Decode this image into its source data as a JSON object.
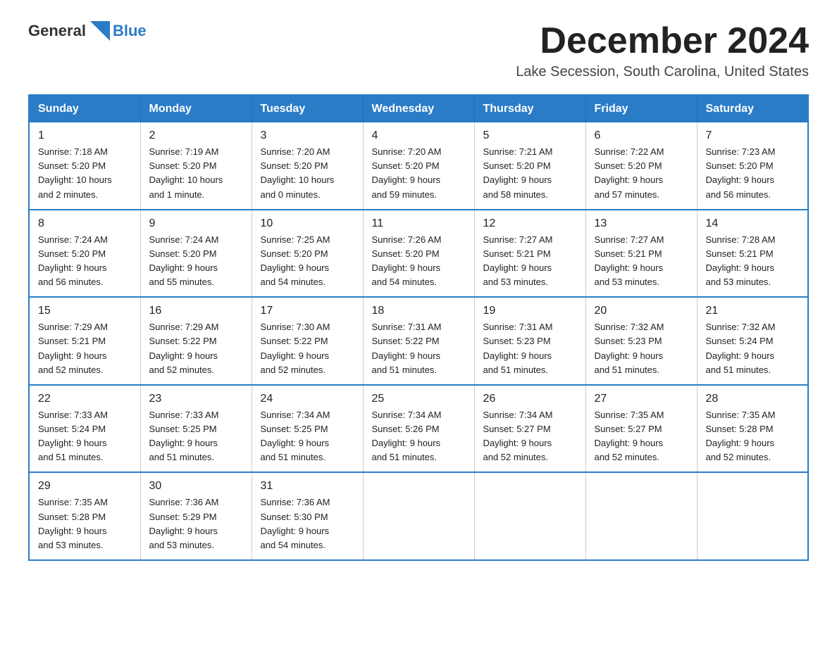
{
  "logo": {
    "general": "General",
    "blue": "Blue"
  },
  "header": {
    "title": "December 2024",
    "subtitle": "Lake Secession, South Carolina, United States"
  },
  "weekdays": [
    "Sunday",
    "Monday",
    "Tuesday",
    "Wednesday",
    "Thursday",
    "Friday",
    "Saturday"
  ],
  "weeks": [
    [
      {
        "day": "1",
        "sunrise": "7:18 AM",
        "sunset": "5:20 PM",
        "daylight": "10 hours and 2 minutes."
      },
      {
        "day": "2",
        "sunrise": "7:19 AM",
        "sunset": "5:20 PM",
        "daylight": "10 hours and 1 minute."
      },
      {
        "day": "3",
        "sunrise": "7:20 AM",
        "sunset": "5:20 PM",
        "daylight": "10 hours and 0 minutes."
      },
      {
        "day": "4",
        "sunrise": "7:20 AM",
        "sunset": "5:20 PM",
        "daylight": "9 hours and 59 minutes."
      },
      {
        "day": "5",
        "sunrise": "7:21 AM",
        "sunset": "5:20 PM",
        "daylight": "9 hours and 58 minutes."
      },
      {
        "day": "6",
        "sunrise": "7:22 AM",
        "sunset": "5:20 PM",
        "daylight": "9 hours and 57 minutes."
      },
      {
        "day": "7",
        "sunrise": "7:23 AM",
        "sunset": "5:20 PM",
        "daylight": "9 hours and 56 minutes."
      }
    ],
    [
      {
        "day": "8",
        "sunrise": "7:24 AM",
        "sunset": "5:20 PM",
        "daylight": "9 hours and 56 minutes."
      },
      {
        "day": "9",
        "sunrise": "7:24 AM",
        "sunset": "5:20 PM",
        "daylight": "9 hours and 55 minutes."
      },
      {
        "day": "10",
        "sunrise": "7:25 AM",
        "sunset": "5:20 PM",
        "daylight": "9 hours and 54 minutes."
      },
      {
        "day": "11",
        "sunrise": "7:26 AM",
        "sunset": "5:20 PM",
        "daylight": "9 hours and 54 minutes."
      },
      {
        "day": "12",
        "sunrise": "7:27 AM",
        "sunset": "5:21 PM",
        "daylight": "9 hours and 53 minutes."
      },
      {
        "day": "13",
        "sunrise": "7:27 AM",
        "sunset": "5:21 PM",
        "daylight": "9 hours and 53 minutes."
      },
      {
        "day": "14",
        "sunrise": "7:28 AM",
        "sunset": "5:21 PM",
        "daylight": "9 hours and 53 minutes."
      }
    ],
    [
      {
        "day": "15",
        "sunrise": "7:29 AM",
        "sunset": "5:21 PM",
        "daylight": "9 hours and 52 minutes."
      },
      {
        "day": "16",
        "sunrise": "7:29 AM",
        "sunset": "5:22 PM",
        "daylight": "9 hours and 52 minutes."
      },
      {
        "day": "17",
        "sunrise": "7:30 AM",
        "sunset": "5:22 PM",
        "daylight": "9 hours and 52 minutes."
      },
      {
        "day": "18",
        "sunrise": "7:31 AM",
        "sunset": "5:22 PM",
        "daylight": "9 hours and 51 minutes."
      },
      {
        "day": "19",
        "sunrise": "7:31 AM",
        "sunset": "5:23 PM",
        "daylight": "9 hours and 51 minutes."
      },
      {
        "day": "20",
        "sunrise": "7:32 AM",
        "sunset": "5:23 PM",
        "daylight": "9 hours and 51 minutes."
      },
      {
        "day": "21",
        "sunrise": "7:32 AM",
        "sunset": "5:24 PM",
        "daylight": "9 hours and 51 minutes."
      }
    ],
    [
      {
        "day": "22",
        "sunrise": "7:33 AM",
        "sunset": "5:24 PM",
        "daylight": "9 hours and 51 minutes."
      },
      {
        "day": "23",
        "sunrise": "7:33 AM",
        "sunset": "5:25 PM",
        "daylight": "9 hours and 51 minutes."
      },
      {
        "day": "24",
        "sunrise": "7:34 AM",
        "sunset": "5:25 PM",
        "daylight": "9 hours and 51 minutes."
      },
      {
        "day": "25",
        "sunrise": "7:34 AM",
        "sunset": "5:26 PM",
        "daylight": "9 hours and 51 minutes."
      },
      {
        "day": "26",
        "sunrise": "7:34 AM",
        "sunset": "5:27 PM",
        "daylight": "9 hours and 52 minutes."
      },
      {
        "day": "27",
        "sunrise": "7:35 AM",
        "sunset": "5:27 PM",
        "daylight": "9 hours and 52 minutes."
      },
      {
        "day": "28",
        "sunrise": "7:35 AM",
        "sunset": "5:28 PM",
        "daylight": "9 hours and 52 minutes."
      }
    ],
    [
      {
        "day": "29",
        "sunrise": "7:35 AM",
        "sunset": "5:28 PM",
        "daylight": "9 hours and 53 minutes."
      },
      {
        "day": "30",
        "sunrise": "7:36 AM",
        "sunset": "5:29 PM",
        "daylight": "9 hours and 53 minutes."
      },
      {
        "day": "31",
        "sunrise": "7:36 AM",
        "sunset": "5:30 PM",
        "daylight": "9 hours and 54 minutes."
      },
      null,
      null,
      null,
      null
    ]
  ],
  "labels": {
    "sunrise": "Sunrise:",
    "sunset": "Sunset:",
    "daylight": "Daylight:"
  }
}
